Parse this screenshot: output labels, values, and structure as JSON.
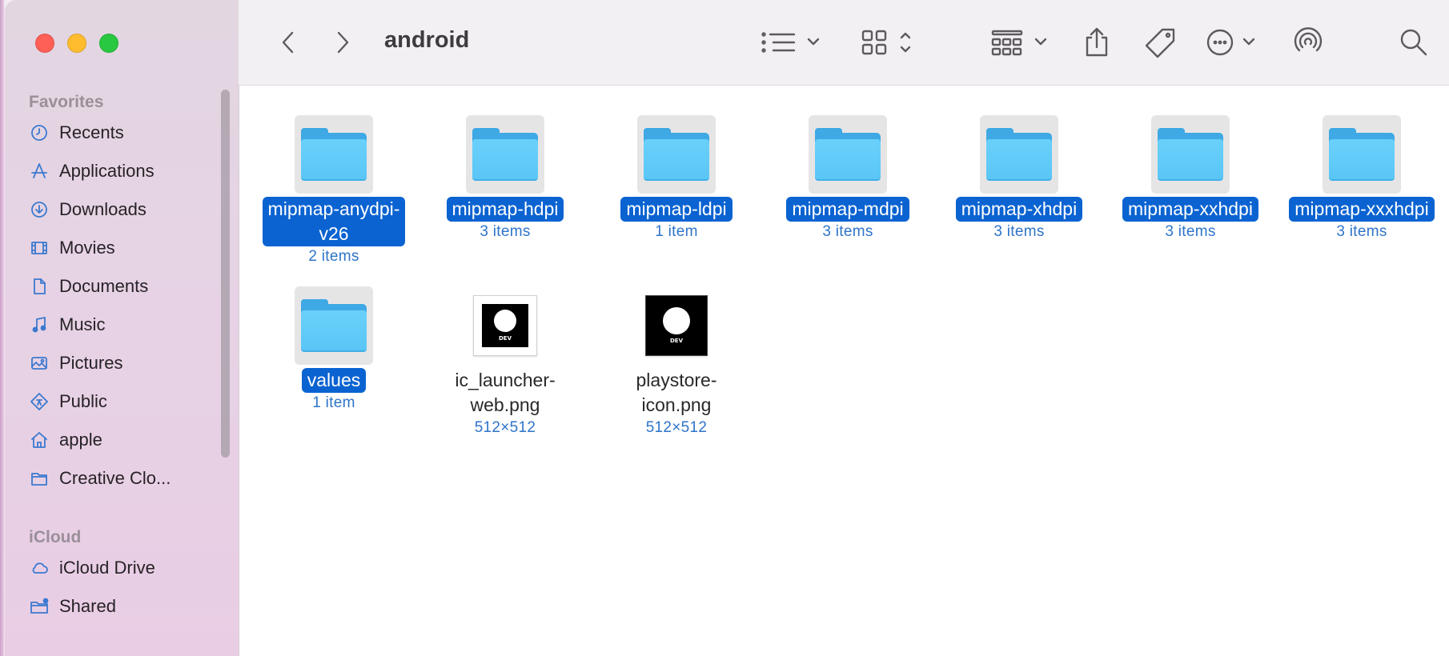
{
  "window": {
    "title": "android"
  },
  "sidebar": {
    "favorites_label": "Favorites",
    "favorites": [
      {
        "label": "Recents",
        "icon": "clock-icon"
      },
      {
        "label": "Applications",
        "icon": "applications-icon"
      },
      {
        "label": "Downloads",
        "icon": "download-icon"
      },
      {
        "label": "Movies",
        "icon": "film-icon"
      },
      {
        "label": "Documents",
        "icon": "document-icon"
      },
      {
        "label": "Music",
        "icon": "music-note-icon"
      },
      {
        "label": "Pictures",
        "icon": "photo-icon"
      },
      {
        "label": "Public",
        "icon": "public-icon"
      },
      {
        "label": "apple",
        "icon": "home-icon"
      },
      {
        "label": "Creative Clo...",
        "icon": "folder-icon"
      }
    ],
    "icloud_label": "iCloud",
    "icloud": [
      {
        "label": "iCloud Drive",
        "icon": "cloud-icon"
      },
      {
        "label": "Shared",
        "icon": "shared-folder-icon"
      }
    ]
  },
  "items": [
    {
      "name": "mipmap-anydpi-v26",
      "line1": "mipmap-anydpi-",
      "line2": "v26",
      "meta": "2 items",
      "kind": "folder",
      "selected": true
    },
    {
      "name": "mipmap-hdpi",
      "meta": "3 items",
      "kind": "folder",
      "selected": true
    },
    {
      "name": "mipmap-ldpi",
      "meta": "1 item",
      "kind": "folder",
      "selected": true
    },
    {
      "name": "mipmap-mdpi",
      "meta": "3 items",
      "kind": "folder",
      "selected": true
    },
    {
      "name": "mipmap-xhdpi",
      "meta": "3 items",
      "kind": "folder",
      "selected": true
    },
    {
      "name": "mipmap-xxhdpi",
      "meta": "3 items",
      "kind": "folder",
      "selected": true
    },
    {
      "name": "mipmap-xxxhdpi",
      "meta": "3 items",
      "kind": "folder",
      "selected": true
    },
    {
      "name": "values",
      "meta": "1 item",
      "kind": "folder",
      "selected": true
    },
    {
      "line1": "ic_launcher-",
      "line2": "web.png",
      "meta": "512×512",
      "kind": "image",
      "selected": false,
      "thumb_text": "DEV"
    },
    {
      "line1": "playstore-",
      "line2": "icon.png",
      "meta": "512×512",
      "kind": "image",
      "selected": false,
      "thumb_text": "DEV"
    }
  ],
  "colors": {
    "selection": "#0a63d1",
    "folder": "#5ac6f6",
    "accent": "#3b79cf"
  }
}
